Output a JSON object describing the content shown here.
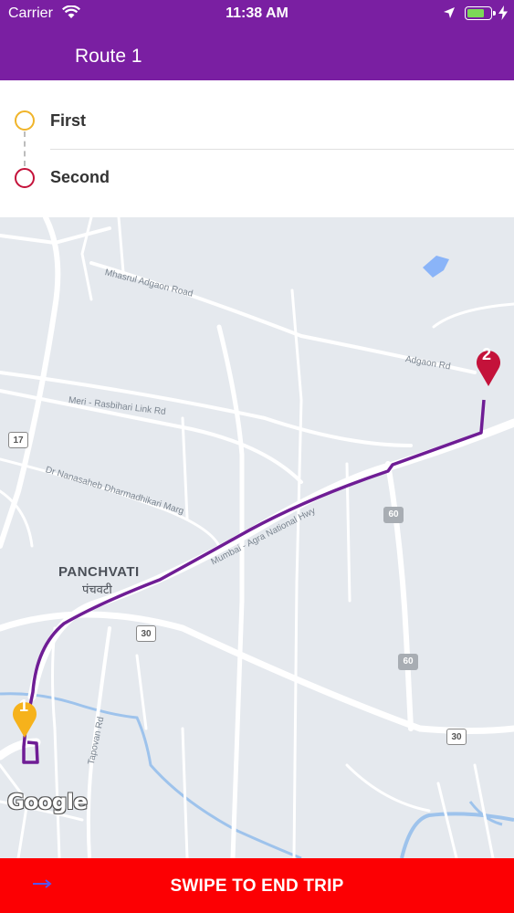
{
  "status_bar": {
    "carrier": "Carrier",
    "time": "11:38 AM",
    "battery_level": 0.8
  },
  "nav": {
    "title": "Route 1"
  },
  "stops": [
    {
      "label": "First",
      "color": "#f0b429"
    },
    {
      "label": "Second",
      "color": "#c4123a"
    }
  ],
  "map": {
    "road_labels": [
      "Mhasrul Adgaon Road",
      "Adgaon Rd",
      "Meri - Rasbihari Link Rd",
      "Dr Nanasaheb Dharmadhikari Marg",
      "Mumbai - Agra National Hwy",
      "Tapovan Rd"
    ],
    "place": {
      "name": "PANCHVATI",
      "name_local": "पंचवटी"
    },
    "shields": [
      "17",
      "30",
      "60",
      "60",
      "30"
    ],
    "markers": [
      "1",
      "2"
    ],
    "marker_colors": {
      "start": "#f6b21b",
      "end": "#c4123a"
    },
    "route_color": "#6f1d95",
    "attribution": "Google"
  },
  "action": {
    "label": "SWIPE TO END TRIP",
    "color": "#fc0003"
  }
}
